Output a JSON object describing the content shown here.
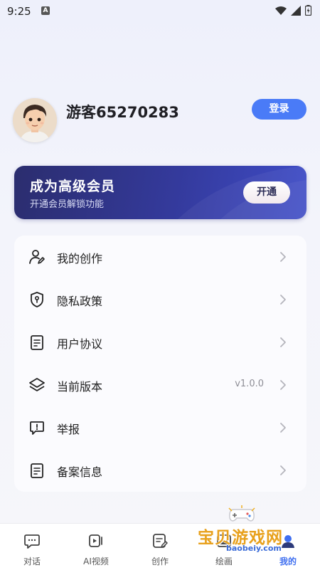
{
  "status_bar": {
    "time": "9:25",
    "badge": "A"
  },
  "profile": {
    "username": "游客65270283",
    "login_label": "登录"
  },
  "vip": {
    "title": "成为高级会员",
    "subtitle": "开通会员解锁功能",
    "button_label": "开通"
  },
  "menu": {
    "items": [
      {
        "label": "我的创作",
        "icon": "user-edit-icon",
        "value": ""
      },
      {
        "label": "隐私政策",
        "icon": "shield-icon",
        "value": ""
      },
      {
        "label": "用户协议",
        "icon": "document-icon",
        "value": ""
      },
      {
        "label": "当前版本",
        "icon": "layers-icon",
        "value": "v1.0.0"
      },
      {
        "label": "举报",
        "icon": "report-icon",
        "value": ""
      },
      {
        "label": "备案信息",
        "icon": "record-icon",
        "value": ""
      }
    ]
  },
  "tabs": [
    {
      "label": "对话",
      "icon": "chat-icon",
      "active": false
    },
    {
      "label": "AI视频",
      "icon": "video-icon",
      "active": false
    },
    {
      "label": "创作",
      "icon": "create-icon",
      "active": false
    },
    {
      "label": "绘画",
      "icon": "paint-icon",
      "active": false
    },
    {
      "label": "我的",
      "icon": "profile-icon",
      "active": true
    }
  ],
  "watermark": {
    "text": "宝贝游戏网",
    "url": "baobeiy.com"
  },
  "colors": {
    "accent": "#4a7bf7",
    "vip_start": "#2b2d6e",
    "vip_end": "#3f4cc7",
    "active_tab": "#3f6ff0"
  }
}
